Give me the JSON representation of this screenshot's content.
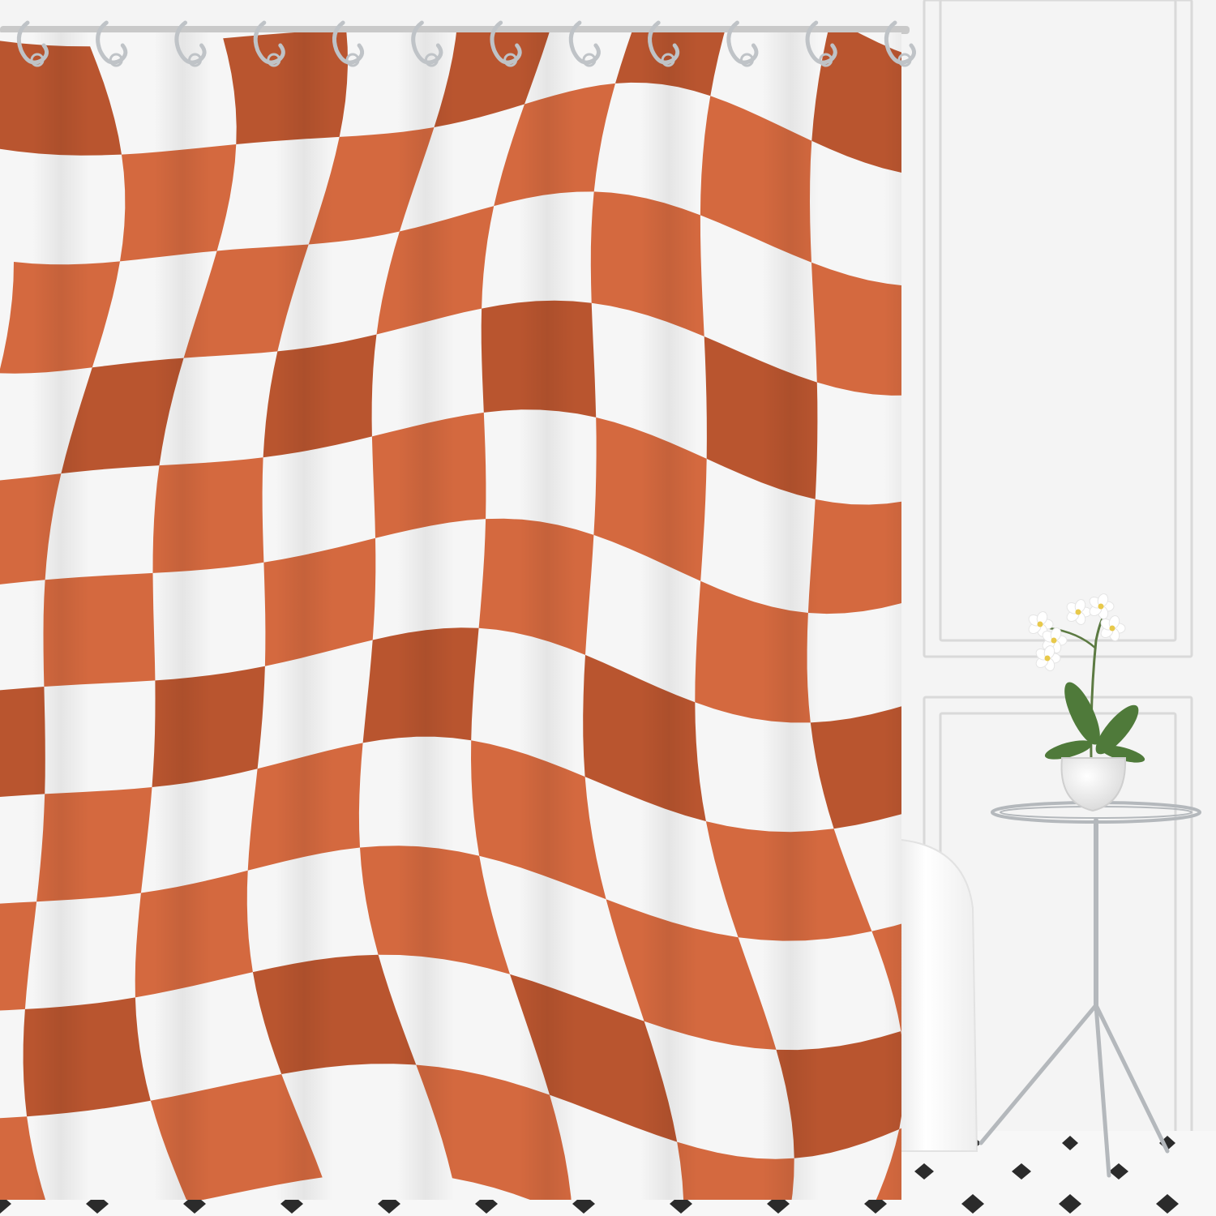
{
  "scene": {
    "subject": "shower-curtain",
    "pattern": "wavy-checkerboard",
    "hook_count": 12,
    "colors": {
      "wall": "#f4f4f4",
      "wall_panel_edge": "#d9d9d9",
      "floor": "#f7f7f7",
      "floor_diamond": "#2b2b2b",
      "curtain_white": "#f6f6f6",
      "curtain_orange": "#d4693f",
      "curtain_orange_shadow": "#b9552f",
      "rod": "#c9c9c9",
      "hook": "#bfc3c7",
      "tub": "#fbfbfb",
      "table_metal": "#b4b8bc",
      "pot": "#fdfdfd",
      "leaf": "#4f7a3a",
      "flower": "#ffffff",
      "flower_center": "#e8c94b"
    }
  }
}
